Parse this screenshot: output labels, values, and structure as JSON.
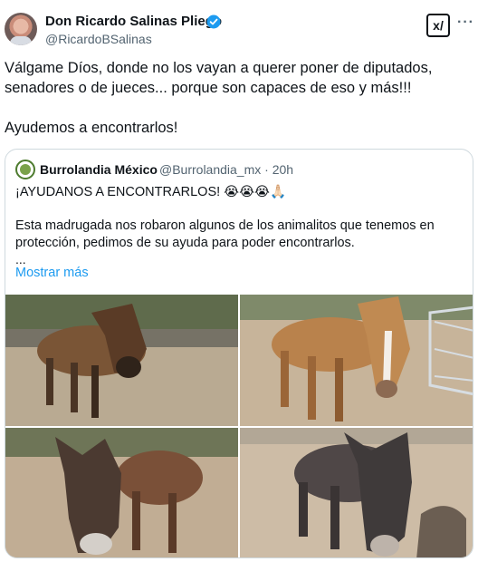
{
  "author": {
    "name": "Don Ricardo Salinas Pliego",
    "handle": "@RicardoBSalinas"
  },
  "header_actions": {
    "grok_label": "x/",
    "more_label": "···"
  },
  "post": {
    "lines": [
      "Válgame Díos, donde no los vayan a querer poner de diputados,",
      "senadores o de jueces... porque son capaces de eso y más!!!",
      "Ayudemos a encontrarlos!"
    ]
  },
  "quoted": {
    "name": "Burrolandia México",
    "handle_time": "@Burrolandia_mx · 20h",
    "title": "¡AYUDANOS A ENCONTRARLOS! 😭😭😭🙏🏻",
    "body": "Esta madrugada nos robaron algunos de los animalitos que tenemos en protección, pedimos de su ayuda para poder encontrarlos.",
    "ellipsis": "...",
    "show_more": "Mostrar más"
  },
  "colors": {
    "verified_badge": "#1d9bf0",
    "link": "#1d9bf0",
    "secondary_text": "#536471",
    "border": "#cfd9de"
  },
  "icons": [
    "verified-badge-icon",
    "grok-icon",
    "more-options-icon"
  ]
}
